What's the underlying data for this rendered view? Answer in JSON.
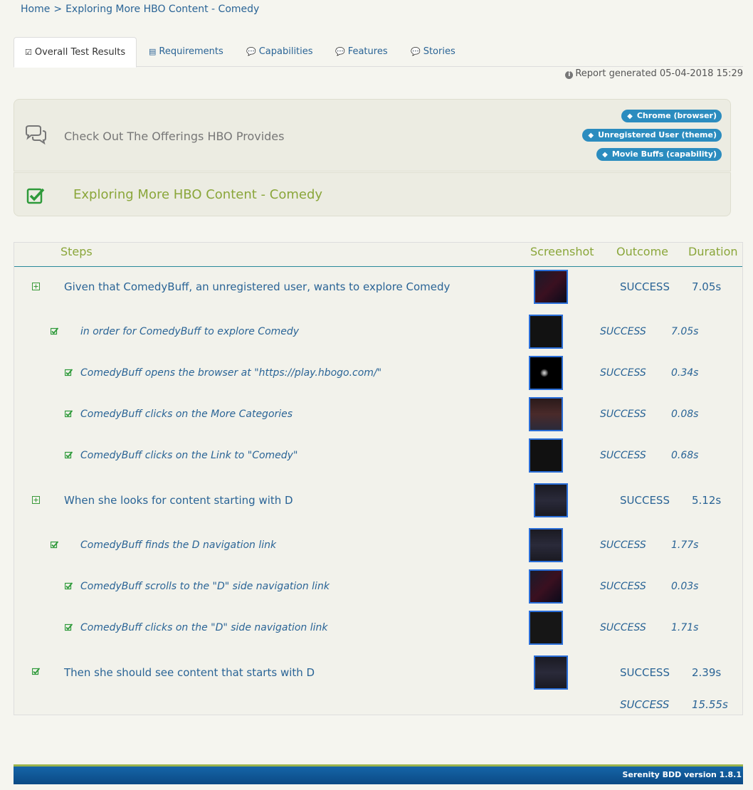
{
  "breadcrumb": {
    "home": "Home",
    "separator": ">",
    "current": "Exploring More HBO Content - Comedy"
  },
  "tabs": [
    {
      "label": "Overall Test Results",
      "icon": "check-square-icon"
    },
    {
      "label": "Requirements",
      "icon": "book-icon"
    },
    {
      "label": "Capabilities",
      "icon": "comments-icon"
    },
    {
      "label": "Features",
      "icon": "comments-icon"
    },
    {
      "label": "Stories",
      "icon": "comments-icon"
    }
  ],
  "report": {
    "generated": "Report generated 05-04-2018 15:29"
  },
  "story": {
    "title": "Check Out The Offerings HBO Provides",
    "tags": [
      "Chrome (browser)",
      "Unregistered User (theme)",
      "Movie Buffs (capability)"
    ]
  },
  "scenario": {
    "title": "Exploring More HBO Content - Comedy"
  },
  "table": {
    "headers": {
      "steps": "Steps",
      "screenshot": "Screenshot",
      "outcome": "Outcome",
      "duration": "Duration"
    },
    "rows": [
      {
        "text": "Given that ComedyBuff, an unregistered user, wants to explore Comedy",
        "outcome": "SUCCESS",
        "duration": "7.05s"
      },
      {
        "text": "in order for ComedyBuff to explore Comedy",
        "outcome": "SUCCESS",
        "duration": "7.05s"
      },
      {
        "text": "ComedyBuff opens the browser at \"https://play.hbogo.com/\"",
        "outcome": "SUCCESS",
        "duration": "0.34s"
      },
      {
        "text": "ComedyBuff clicks on the More Categories",
        "outcome": "SUCCESS",
        "duration": "0.08s"
      },
      {
        "text": "ComedyBuff clicks on the Link to \"Comedy\"",
        "outcome": "SUCCESS",
        "duration": "0.68s"
      },
      {
        "text": "When she looks for content starting with D",
        "outcome": "SUCCESS",
        "duration": "5.12s"
      },
      {
        "text": "ComedyBuff finds the D navigation link",
        "outcome": "SUCCESS",
        "duration": "1.77s"
      },
      {
        "text": "ComedyBuff scrolls to the \"D\" side navigation link",
        "outcome": "SUCCESS",
        "duration": "0.03s"
      },
      {
        "text": "ComedyBuff clicks on the \"D\" side navigation link",
        "outcome": "SUCCESS",
        "duration": "1.71s"
      },
      {
        "text": "Then she should see content that starts with D",
        "outcome": "SUCCESS",
        "duration": "2.39s"
      }
    ],
    "total": {
      "outcome": "SUCCESS",
      "duration": "15.55s"
    }
  },
  "footer": {
    "version": "Serenity BDD version 1.8.1"
  },
  "colors": {
    "link": "#2a6496",
    "accent_green": "#8aa63a",
    "tag_blue": "#2b8cbf",
    "check_green": "#2e9a3a"
  }
}
